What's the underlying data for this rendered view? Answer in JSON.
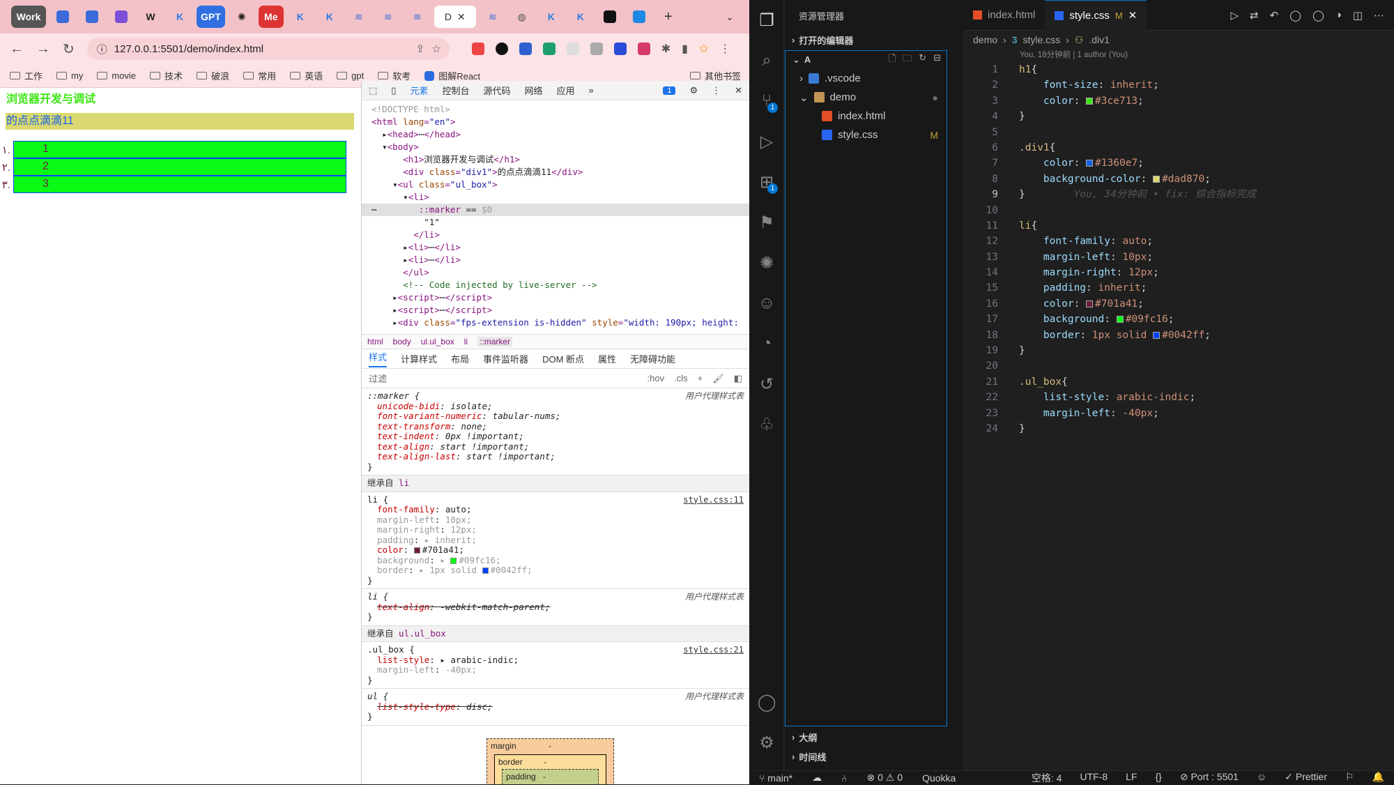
{
  "browser": {
    "tabs": [
      "Work",
      "GPT",
      "Me",
      "D"
    ],
    "address": "127.0.0.1:5501/demo/index.html",
    "bookmarks": [
      "工作",
      "my",
      "movie",
      "技术",
      "破浪",
      "常用",
      "英语",
      "gpt",
      "软考",
      "图解React"
    ],
    "other_bookmarks": "其他书签"
  },
  "page": {
    "h1": "浏览器开发与调试",
    "div1": "的点点滴滴11",
    "list": [
      {
        "marker": "١.",
        "text": "1"
      },
      {
        "marker": "٢.",
        "text": "2"
      },
      {
        "marker": "٣.",
        "text": "3"
      }
    ]
  },
  "devtools": {
    "tabs": [
      "元素",
      "控制台",
      "源代码",
      "网络",
      "应用"
    ],
    "issue_count": "1",
    "breadcrumbs": [
      "html",
      "body",
      "ul.ul_box",
      "li",
      "::marker"
    ],
    "subtabs": [
      "样式",
      "计算样式",
      "布局",
      "事件监听器",
      "DOM 断点",
      "属性",
      "无障碍功能"
    ],
    "filter": "过滤",
    "hov": ":hov",
    "cls": ".cls",
    "user_agent": "用户代理样式表",
    "inherited_li": "继承自",
    "inherited_li_tag": "li",
    "inherited_ul": "继承自",
    "inherited_ul_tag": "ul.ul_box",
    "src_li": "style.css:11",
    "src_ul": "style.css:21",
    "box_margin": "margin",
    "box_border": "border",
    "box_padding": "padding",
    "box_dash": "-"
  },
  "vscode": {
    "explorer_title": "资源管理器",
    "open_editors": "打开的编辑器",
    "root": "A",
    "tree": [
      ".vscode",
      "demo",
      "index.html",
      "style.css"
    ],
    "outline": "大纲",
    "timeline": "时间线",
    "tabs": [
      "index.html",
      "style.css"
    ],
    "tab_modified": "M",
    "breadcrumb": [
      "demo",
      "style.css",
      ".div1"
    ],
    "blame": "You, 18分钟前 | 1 author (You)",
    "ghost_blame": "You, 34分钟前 • fix: 综合指标完成",
    "status": {
      "branch": "main*",
      "errors": "0",
      "warnings": "0",
      "quokka": "Quokka",
      "spaces": "空格: 4",
      "encoding": "UTF-8",
      "eol": "LF",
      "port": "Port : 5501",
      "prettier": "Prettier"
    }
  },
  "colors": {
    "h1": "#3ce713",
    "div1_color": "#1360e7",
    "div1_bg": "#dad870",
    "li_color": "#701a41",
    "li_bg": "#09fc16",
    "li_border": "#0042ff"
  }
}
